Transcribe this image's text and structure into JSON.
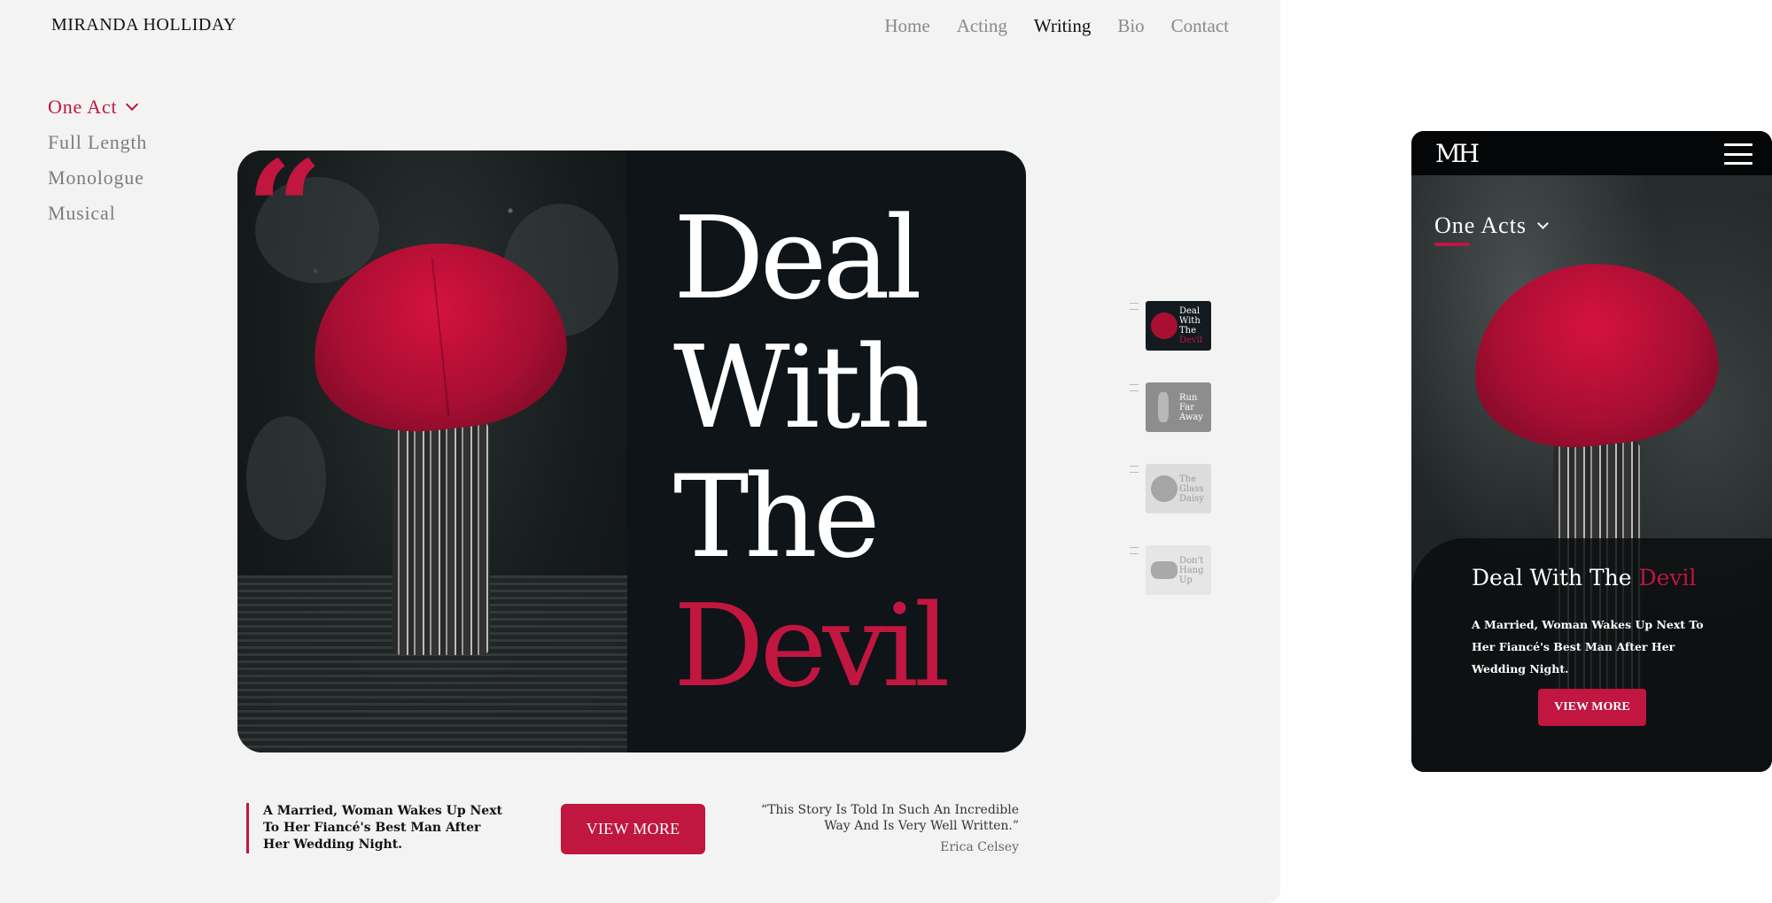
{
  "site": {
    "brand": "MIRANDA HOLLIDAY"
  },
  "nav": [
    {
      "label": "Home",
      "active": false
    },
    {
      "label": "Acting",
      "active": false
    },
    {
      "label": "Writing",
      "active": true
    },
    {
      "label": "Bio",
      "active": false
    },
    {
      "label": "Contact",
      "active": false
    }
  ],
  "side_nav": [
    {
      "label": "One Act",
      "active": true
    },
    {
      "label": "Full Length",
      "active": false
    },
    {
      "label": "Monologue",
      "active": false
    },
    {
      "label": "Musical",
      "active": false
    }
  ],
  "hero": {
    "quote_mark": "“",
    "title_lines": [
      "Deal",
      "With",
      "The"
    ],
    "title_accent": "Devil"
  },
  "thumbnails": [
    {
      "lines": [
        "Deal",
        "With",
        "The"
      ],
      "accent": "Devil"
    },
    {
      "lines": [
        "Run",
        "Far"
      ],
      "accent": "Away"
    },
    {
      "lines": [
        "The",
        "Glass"
      ],
      "accent": "Daisy"
    },
    {
      "lines": [
        "Don't",
        "Hang"
      ],
      "accent": "Up"
    }
  ],
  "summary": "A Married, Woman Wakes Up Next To Her Fiancé's Best Man After Her Wedding Night.",
  "cta": {
    "label": "VIEW MORE"
  },
  "review": {
    "quote": "“This Story Is Told In Such An Incredible Way And Is Very Well Written.”",
    "author": "Erica Celsey"
  },
  "mobile": {
    "logo": "MH",
    "section": "One Acts",
    "title": "Deal With The",
    "title_accent": "Devil",
    "description": "A Married, Woman Wakes Up Next To Her Fiancé's Best Man After Her Wedding Night.",
    "cta": "VIEW MORE"
  },
  "colors": {
    "accent": "#c0163f",
    "dark": "#0e1418",
    "background": "#f3f3f3"
  },
  "icons": [
    "chevron-down-icon",
    "quote-icon",
    "hamburger-menu-icon"
  ]
}
